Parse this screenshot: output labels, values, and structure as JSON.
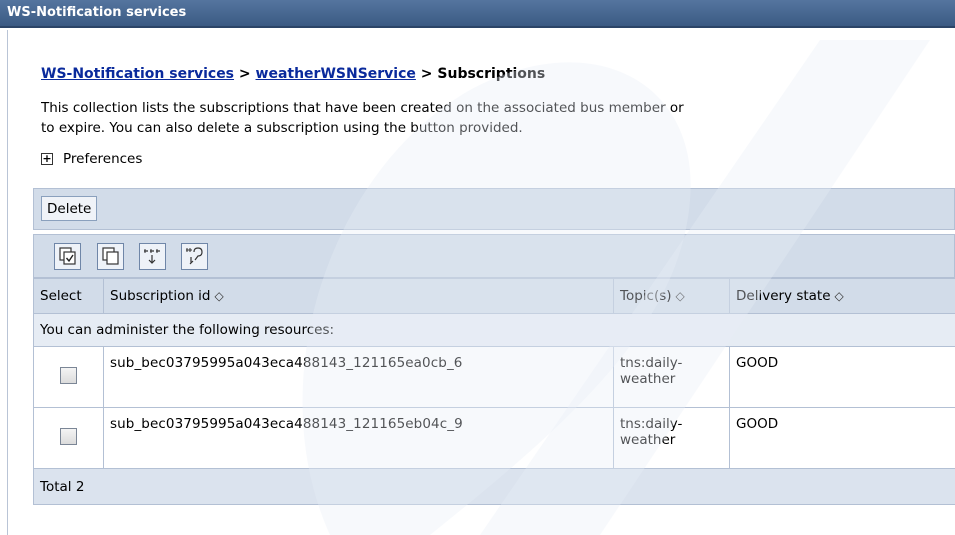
{
  "window": {
    "title": "WS-Notification services"
  },
  "breadcrumb": {
    "links": [
      "WS-Notification services",
      "weatherWSNService"
    ],
    "separator": ">",
    "current": "Subscriptions"
  },
  "description": {
    "line1": "This collection lists the subscriptions that have been created on the associated bus member or",
    "line2": "to expire. You can also delete a subscription using the button provided."
  },
  "preferences": {
    "expander": "+",
    "label": "Preferences"
  },
  "toolbar": {
    "delete_label": "Delete",
    "icons": [
      "select-all-icon",
      "deselect-all-icon",
      "show-filter-icon",
      "clear-filter-icon"
    ]
  },
  "table": {
    "headers": [
      "Select",
      "Subscription id",
      "Topic(s)",
      "Delivery state"
    ],
    "sort_glyph": "◇",
    "group_text": "You can administer the following resources:",
    "rows": [
      {
        "id": "sub_bec03795995a043eca488143_121165ea0cb_6",
        "topic_line1": "tns:daily-",
        "topic_line2": "weather",
        "state": "GOOD",
        "checked": false
      },
      {
        "id": "sub_bec03795995a043eca488143_121165eb04c_9",
        "topic_line1": "tns:daily-",
        "topic_line2": "weather",
        "state": "GOOD",
        "checked": false
      }
    ],
    "total": "Total 2"
  },
  "colors": {
    "title_bar": "#3b5a83",
    "link": "#0a2a9c",
    "header_bg": "#d2dce9"
  }
}
